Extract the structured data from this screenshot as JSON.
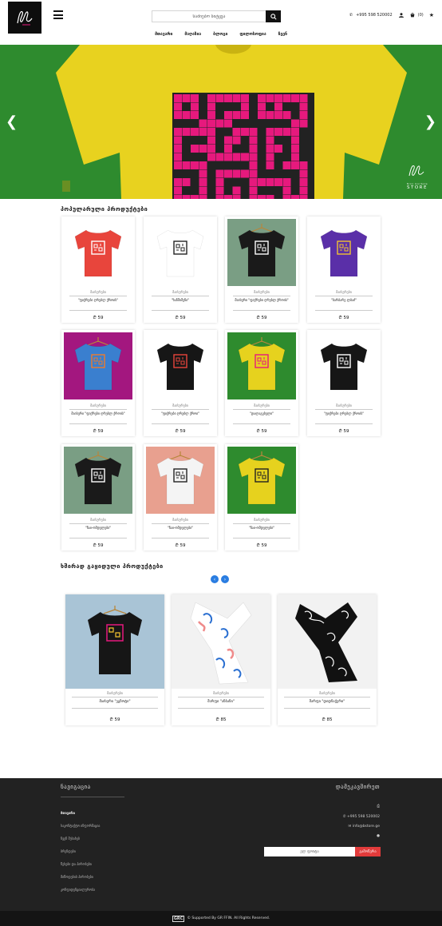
{
  "header": {
    "search_placeholder": "საძიებო სიტყვა",
    "phone": "+995 598 520002",
    "cart_count": "(0)",
    "nav": [
      "მთავარი",
      "მაღაზია",
      "ბლოგი",
      "ფილოსოფია",
      "ჩვენ"
    ]
  },
  "hero": {
    "brand_small": "Nino Gordeze",
    "brand_store": "STORE",
    "shirt_color": "#e8d21f",
    "print_color": "#e6197d",
    "bg_color": "#2e8b2e"
  },
  "popular": {
    "title": "პოპულარული პროდუქტები",
    "products": [
      {
        "category": "მაისურები",
        "name": "\"ფიქრები ღრუბლ ქროის\"",
        "price": "₾ 59",
        "bg": "#ffffff",
        "shirt": "#e8453c",
        "print": "#ffffff"
      },
      {
        "category": "მაისურები",
        "name": "\"ხანშიშენი\"",
        "price": "₾ 59",
        "bg": "#ffffff",
        "shirt": "#ffffff",
        "print": "#222222"
      },
      {
        "category": "მაისურები",
        "name": "მაისური \"ფიქრები ღრუბლ ქროის\"",
        "price": "₾ 59",
        "bg": "#7a9e84",
        "shirt": "#1a1a1a",
        "print": "#ffffff"
      },
      {
        "category": "მაისურები",
        "name": "\"ბარბარე ლბაძ\"",
        "price": "₾ 59",
        "bg": "#ffffff",
        "shirt": "#5a2fa8",
        "print": "#f2c230"
      },
      {
        "category": "მაისურები",
        "name": "მაისური \"ფიქრები ღრუბლ ქროის\"",
        "price": "₾ 59",
        "bg": "#a3177f",
        "shirt": "#3a7fcf",
        "print": "#f07b2a"
      },
      {
        "category": "მაისურები",
        "name": "\"ფიქრები ღრუბლ ქროი\"",
        "price": "₾ 59",
        "bg": "#ffffff",
        "shirt": "#161616",
        "print": "#e8453c"
      },
      {
        "category": "მაისურები",
        "name": "\"დალაგებული\"",
        "price": "₾ 59",
        "bg": "#2e8b2e",
        "shirt": "#e6d21e",
        "print": "#e6197d"
      },
      {
        "category": "მაისურები",
        "name": "\"ფიქრები ღრუბლ ქროის\"",
        "price": "₾ 59",
        "bg": "#ffffff",
        "shirt": "#161616",
        "print": "#ffffff"
      },
      {
        "category": "მაისურები",
        "name": "\"ჩაი-ომდელები\"",
        "price": "₾ 59",
        "bg": "#7a9e84",
        "shirt": "#1a1a1a",
        "print": "#ffffff"
      },
      {
        "category": "მაისურები",
        "name": "\"ჩაი-ომდელები\"",
        "price": "₾ 59",
        "bg": "#e8a08f",
        "shirt": "#f4f4f4",
        "print": "#222222"
      },
      {
        "category": "მაისურები",
        "name": "\"ჩაი-ომდელები\"",
        "price": "₾ 59",
        "bg": "#2e8b2e",
        "shirt": "#e6d21e",
        "print": "#222222"
      }
    ]
  },
  "frequent": {
    "title": "ხშირად გაყიდული პროდუქტები",
    "products": [
      {
        "category": "მაისურები",
        "name": "მაისური \"ეგზოტი\"",
        "price": "₾ 59",
        "bg": "#a9c4d6",
        "kind": "shirt"
      },
      {
        "category": "მაისურები",
        "name": "შარფი \"ანბანი\"",
        "price": "₾ 85",
        "bg": "#f2f2f2",
        "kind": "scarf-light"
      },
      {
        "category": "მაისურები",
        "name": "შარფი \"დიდნაჭერი\"",
        "price": "₾ 85",
        "bg": "#f2f2f2",
        "kind": "scarf-dark"
      }
    ]
  },
  "footer": {
    "nav_title": "ნავიგაცია",
    "links": [
      "მთავარი",
      "საკონტაქტო ინფორმაცია",
      "ჩვენ შესახებ",
      "ბრენდები",
      "წესები და პირობები",
      "მიწოდების პირობები",
      "კონფიდენციალურობა"
    ],
    "contact_title": "დამეკავშირეთ",
    "phone": "+995 598 520002",
    "email": "info@bstore.ge",
    "subscribe_placeholder": "ელ ფოსტა",
    "subscribe_button": "გამოწერა",
    "copyright_logo": "GRC",
    "copyright": "© Supported By GR FFIN. All Rights Reserved."
  }
}
